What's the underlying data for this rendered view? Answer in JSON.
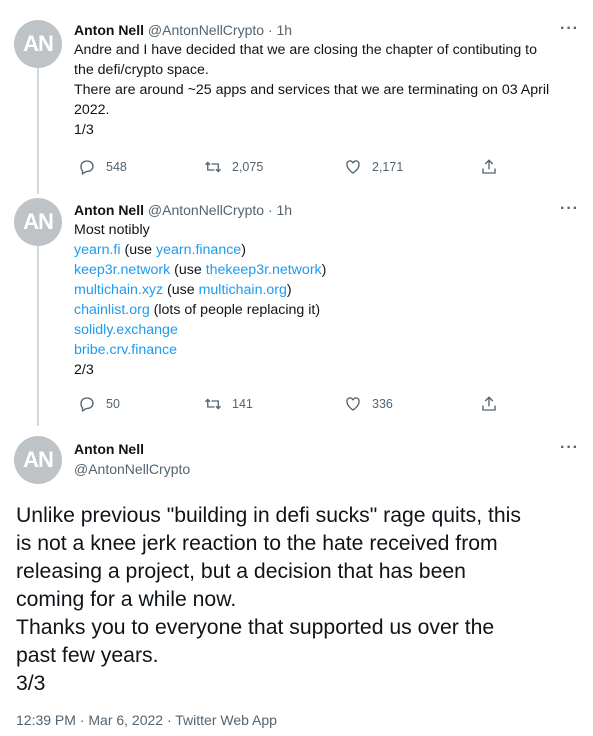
{
  "tweets": [
    {
      "avatar_initials": "AN",
      "name": "Anton Nell",
      "handle": "@AntonNellCrypto",
      "dot": "·",
      "time": "1h",
      "more": "···",
      "lines": [
        "Andre and I have decided that we are closing the chapter of contibuting to",
        "the defi/crypto space.",
        "There are around ~25 apps and services that we are terminating on 03 April",
        "2022.",
        "1/3"
      ],
      "counts": {
        "replies": "548",
        "retweets": "2,075",
        "likes": "2,171"
      }
    },
    {
      "avatar_initials": "AN",
      "name": "Anton Nell",
      "handle": "@AntonNellCrypto",
      "dot": "·",
      "time": "1h",
      "more": "···",
      "intro": "Most notibly",
      "links": [
        {
          "link": "yearn.fi",
          "pre": " (use ",
          "link2": "yearn.finance",
          "post": ")"
        },
        {
          "link": "keep3r.network",
          "pre": " (use ",
          "link2": "thekeep3r.network",
          "post": ")"
        },
        {
          "link": "multichain.xyz",
          "pre": " (use ",
          "link2": "multichain.org",
          "post": ")"
        },
        {
          "link": "chainlist.org",
          "pre": " (lots of people replacing it)",
          "link2": "",
          "post": ""
        },
        {
          "link": "solidly.exchange",
          "pre": "",
          "link2": "",
          "post": ""
        },
        {
          "link": "bribe.crv.finance",
          "pre": "",
          "link2": "",
          "post": ""
        }
      ],
      "footer_line": "2/3",
      "counts": {
        "replies": "50",
        "retweets": "141",
        "likes": "336"
      }
    }
  ],
  "main_tweet": {
    "avatar_initials": "AN",
    "name": "Anton Nell",
    "handle": "@AntonNellCrypto",
    "more": "···",
    "lines": [
      "Unlike previous \"building in defi sucks\" rage quits, this",
      "is not a knee jerk reaction to the hate received from",
      "releasing a project, but a decision that has been",
      "coming for a while now.",
      "Thanks you to everyone that supported us over the",
      "past few years.",
      "3/3"
    ],
    "timestamp": "12:39 PM · Mar 6, 2022 · Twitter Web App"
  },
  "icons": [
    "reply-icon",
    "retweet-icon",
    "like-icon",
    "share-icon",
    "more-icon"
  ],
  "colors": {
    "link": "#1d9bf0",
    "muted": "#536471",
    "text": "#0f1419",
    "avatar_bg": "#bdc3c7",
    "thread_line": "#cfd9de"
  }
}
